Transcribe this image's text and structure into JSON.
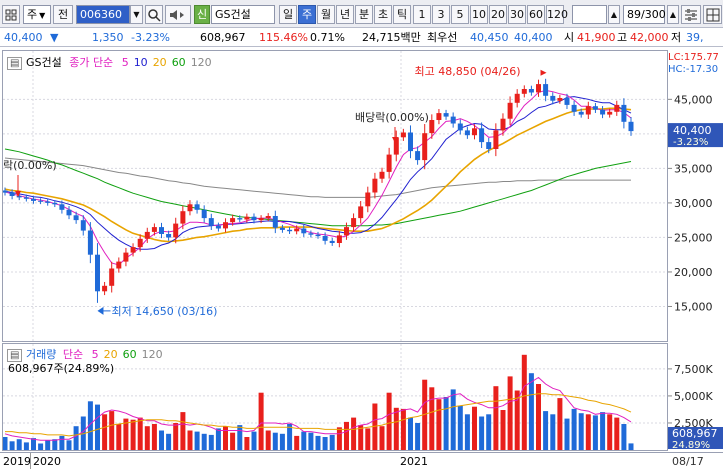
{
  "toolbar": {
    "grid_icon": "grid-icon",
    "market_label": "주",
    "prev_label": "전",
    "code": "006360",
    "search_icon": "search-icon",
    "speaker_icon": "speaker-icon",
    "credit_label": "신",
    "name": "GS건설",
    "periods": [
      "일",
      "주",
      "월",
      "년",
      "분",
      "초",
      "틱"
    ],
    "active_period": "주",
    "minutes": [
      "1",
      "3",
      "5",
      "10",
      "20",
      "30",
      "60",
      "120"
    ],
    "count": "89/300"
  },
  "quote": {
    "price": "40,400",
    "change": "1,350",
    "change_pct": "-3.23%",
    "volume": "608,967",
    "vol_ratio": "115.46%",
    "turnover": "0.71%",
    "amount": "24,715백만",
    "best_label": "최우선",
    "best_ask": "40,450",
    "best_bid": "40,400",
    "open_label": "시",
    "open": "41,900",
    "high_label": "고",
    "high": "42,000",
    "low_label": "저",
    "low": "39,"
  },
  "price_pane": {
    "legend_name": "GS건설",
    "legend_ma_label": "종가 단순",
    "ma_periods": [
      "5",
      "10",
      "20",
      "60",
      "120"
    ],
    "ma_colors": [
      "#e020c0",
      "#2020d0",
      "#e8a400",
      "#10a010",
      "#888888"
    ],
    "annot_high": "최고 48,850 (04/26)",
    "annot_low": "최저 14,650 (03/16)",
    "annot_div1": "배당락(0.00%)",
    "annot_div2": "락(0.00%)",
    "lc": "LC:175.77",
    "hc": "HC:-17.30",
    "last_price": "40,400",
    "last_pct": "-3.23%"
  },
  "volume_pane": {
    "legend_name": "거래량",
    "legend_ma_label": "단순",
    "ma_periods": [
      "5",
      "20",
      "60",
      "120"
    ],
    "value_label": "608,967주(24.89%)",
    "last_volume": "608,967",
    "last_pct": "24.89%"
  },
  "dates": {
    "x_labels": [
      "2019",
      "2020",
      "2021"
    ],
    "end_label": "08/17"
  },
  "colors": {
    "up": "#e8201c",
    "down": "#1f6ad8",
    "accent": "#3b6fd3"
  },
  "chart_data": [
    {
      "type": "candlestick",
      "title": "GS건설",
      "ylim": [
        10000,
        52000
      ],
      "y_ticks": [
        15000,
        20000,
        25000,
        30000,
        35000,
        40000,
        45000
      ],
      "x_labels": [
        "2019",
        "2020",
        "2021"
      ],
      "series": [
        {
          "name": "종가",
          "values": [
            31500,
            31000,
            30800,
            30600,
            30300,
            30200,
            30000,
            29800,
            29000,
            28200,
            27500,
            26000,
            22500,
            17200,
            18000,
            20500,
            21500,
            22800,
            23600,
            24800,
            25800,
            26500,
            25500,
            25000,
            27000,
            28800,
            29800,
            29000,
            27800,
            26700,
            26300,
            27200,
            27800,
            27600,
            28000,
            27500,
            27800,
            28100,
            26400,
            26100,
            25900,
            26300,
            25600,
            25400,
            25200,
            24500,
            24200,
            25300,
            26500,
            27800,
            29500,
            31500,
            33500,
            34500,
            37000,
            39500,
            40200,
            37500,
            36200,
            40100,
            42000,
            43000,
            42500,
            41500,
            40500,
            39800,
            40800,
            38800,
            37800,
            40500,
            42200,
            44500,
            45800,
            46500,
            46000,
            47200,
            45500,
            44800,
            45200,
            44200,
            43200,
            42800,
            44000,
            43500,
            42800,
            43200,
            44200,
            41750,
            40400
          ]
        },
        {
          "name": "5",
          "values": [
            31600,
            31300,
            31050,
            30800,
            30550,
            30400,
            30200,
            29900,
            29600,
            29050,
            28500,
            28050,
            26600,
            24500,
            22800,
            21300,
            21000,
            22000,
            22700,
            23600,
            24800,
            25500,
            25900,
            25800,
            25960,
            26700,
            27200,
            27200,
            27100,
            26800,
            26700,
            27000,
            27000,
            27100,
            27400,
            27700,
            27800,
            27800,
            27550,
            27200,
            26900,
            26500,
            26000,
            25700,
            25500,
            25400,
            25200,
            25000,
            25200,
            25900,
            26800,
            27800,
            29400,
            31100,
            33100,
            35200,
            37000,
            37800,
            38000,
            38800,
            39600,
            40800,
            41800,
            41900,
            42200,
            41800,
            41200,
            40400,
            39500,
            39600,
            40100,
            41100,
            42700,
            44100,
            45000,
            46000,
            46300,
            46100,
            45800,
            45600,
            44900,
            44000,
            44000,
            43700,
            43400,
            43500,
            43500,
            43100,
            42300
          ]
        },
        {
          "name": "10",
          "values": [
            31700,
            31500,
            31300,
            31100,
            30900,
            30800,
            30600,
            30300,
            30100,
            29800,
            29450,
            29000,
            28300,
            27200,
            26300,
            25400,
            24600,
            24000,
            23500,
            23300,
            23300,
            23400,
            23900,
            24200,
            24800,
            25700,
            26200,
            26500,
            26600,
            26700,
            26800,
            26900,
            26900,
            27000,
            27100,
            27200,
            27300,
            27400,
            27300,
            27300,
            27300,
            27100,
            26900,
            26600,
            26300,
            26100,
            25900,
            25800,
            25600,
            25600,
            25700,
            26100,
            26900,
            27900,
            29200,
            30500,
            31900,
            33400,
            34500,
            35400,
            36400,
            37800,
            39200,
            40000,
            40800,
            41200,
            41500,
            41400,
            40700,
            40600,
            40600,
            41000,
            41800,
            42300,
            43100,
            43800,
            44000,
            44400,
            44700,
            45300,
            45400,
            45200,
            45000,
            44700,
            44500,
            44500,
            44000,
            43500,
            43000
          ]
        },
        {
          "name": "20",
          "values": [
            32000,
            31800,
            31700,
            31500,
            31400,
            31200,
            31000,
            30800,
            30600,
            30300,
            30000,
            29700,
            29200,
            28600,
            28000,
            27300,
            26700,
            26100,
            25600,
            25300,
            25000,
            24700,
            24500,
            24400,
            24500,
            24600,
            24800,
            25000,
            25100,
            25300,
            25500,
            25700,
            25900,
            26000,
            26200,
            26300,
            26400,
            26400,
            26400,
            26500,
            26500,
            26500,
            26500,
            26500,
            26400,
            26300,
            26200,
            26100,
            26000,
            25900,
            25900,
            25900,
            26100,
            26300,
            26700,
            27200,
            27700,
            28300,
            28900,
            29600,
            30400,
            31400,
            32400,
            33400,
            34500,
            35400,
            36300,
            37000,
            37600,
            38100,
            38600,
            39200,
            39800,
            40300,
            40800,
            41300,
            41800,
            42200,
            42600,
            43000,
            43300,
            43500,
            43600,
            43600,
            43600,
            43700,
            43700,
            43600,
            43500
          ]
        },
        {
          "name": "60",
          "values": [
            37800,
            37600,
            37400,
            37100,
            36800,
            36500,
            36200,
            35800,
            35500,
            35100,
            34700,
            34300,
            33900,
            33500,
            33000,
            32600,
            32200,
            31800,
            31400,
            31100,
            30800,
            30500,
            30200,
            30000,
            29800,
            29600,
            29400,
            29200,
            29000,
            28800,
            28600,
            28400,
            28200,
            28000,
            27900,
            27800,
            27700,
            27600,
            27500,
            27400,
            27300,
            27200,
            27100,
            27000,
            26900,
            26800,
            26700,
            26700,
            26700,
            26700,
            26700,
            26700,
            26800,
            26800,
            26900,
            27000,
            27200,
            27400,
            27600,
            27800,
            28000,
            28200,
            28400,
            28600,
            28800,
            29100,
            29400,
            29700,
            30000,
            30300,
            30600,
            30900,
            31200,
            31500,
            31800,
            32200,
            32600,
            33000,
            33400,
            33800,
            34100,
            34400,
            34700,
            35000,
            35200,
            35400,
            35600,
            35800,
            36000
          ]
        },
        {
          "name": "120",
          "values": [
            36500,
            36400,
            36300,
            36200,
            36100,
            36000,
            35900,
            35800,
            35700,
            35600,
            35500,
            35400,
            35200,
            35000,
            34800,
            34600,
            34400,
            34300,
            34100,
            33900,
            33800,
            33600,
            33400,
            33200,
            33100,
            32900,
            32800,
            32600,
            32400,
            32300,
            32200,
            32100,
            32000,
            31900,
            31800,
            31700,
            31600,
            31500,
            31400,
            31300,
            31200,
            31100,
            31000,
            30900,
            30900,
            30800,
            30800,
            30800,
            30800,
            30800,
            30800,
            30800,
            30900,
            31000,
            31100,
            31200,
            31400,
            31600,
            31800,
            32000,
            32200,
            32300,
            32400,
            32500,
            32600,
            32700,
            32800,
            32900,
            33000,
            33000,
            33100,
            33100,
            33200,
            33200,
            33200,
            33300,
            33300,
            33300,
            33300,
            33300,
            33300,
            33300,
            33300,
            33300,
            33300,
            33300,
            33300,
            33300,
            33300
          ]
        }
      ]
    },
    {
      "type": "bar",
      "title": "거래량",
      "ylim": [
        0,
        9800000
      ],
      "y_ticks": [
        2500000,
        5000000,
        7500000
      ],
      "series": [
        {
          "name": "거래량",
          "values": [
            1200000,
            800000,
            1000000,
            700000,
            1100000,
            600000,
            900000,
            1000000,
            1300000,
            900000,
            2200000,
            3100000,
            4500000,
            4200000,
            3300000,
            3600000,
            2400000,
            2900000,
            2800000,
            3000000,
            2200000,
            2400000,
            1800000,
            1500000,
            2500000,
            3500000,
            1800000,
            1700000,
            1500000,
            1400000,
            2000000,
            2200000,
            1600000,
            2300000,
            1200000,
            1700000,
            5300000,
            1800000,
            1600000,
            1500000,
            2400000,
            1300000,
            1700000,
            1600000,
            1300000,
            1200000,
            1400000,
            2100000,
            2600000,
            3000000,
            2300000,
            2000000,
            4300000,
            2200000,
            5300000,
            3900000,
            3800000,
            3000000,
            2500000,
            6500000,
            5800000,
            4700000,
            4900000,
            5600000,
            4100000,
            3300000,
            4000000,
            3100000,
            3300000,
            5900000,
            3700000,
            6800000,
            5500000,
            8800000,
            7100000,
            6100000,
            3600000,
            3300000,
            4800000,
            2900000,
            3800000,
            3400000,
            3300000,
            3200000,
            3500000,
            3300000,
            3000000,
            2400000,
            610000
          ]
        },
        {
          "name": "5",
          "values": [
            1500000,
            1300000,
            1200000,
            1100000,
            1000000,
            900000,
            900000,
            900000,
            1000000,
            1000000,
            1300000,
            1700000,
            2400000,
            3000000,
            3500000,
            3700000,
            3600000,
            3400000,
            3100000,
            2900000,
            2700000,
            2700000,
            2400000,
            2300000,
            2300000,
            2400000,
            2300000,
            2400000,
            2300000,
            2100000,
            1800000,
            1800000,
            1800000,
            1800000,
            1700000,
            1800000,
            2500000,
            2500000,
            2500000,
            2400000,
            2500000,
            2200000,
            1700000,
            1700000,
            1600000,
            1500000,
            1500000,
            1500000,
            1700000,
            2100000,
            2300000,
            2400000,
            2800000,
            2900000,
            3300000,
            3500000,
            3700000,
            3800000,
            3500000,
            4400000,
            4700000,
            4800000,
            4800000,
            5100000,
            5200000,
            4700000,
            4400000,
            4200000,
            3900000,
            3900000,
            4100000,
            4500000,
            4600000,
            5900000,
            6300000,
            6700000,
            6100000,
            5700000,
            5500000,
            4700000,
            3900000,
            3700000,
            3600000,
            3300000,
            3400000,
            3400000,
            3300000,
            3000000,
            2600000
          ]
        },
        {
          "name": "20",
          "values": [
            1700000,
            1700000,
            1600000,
            1600000,
            1500000,
            1500000,
            1400000,
            1400000,
            1400000,
            1300000,
            1400000,
            1500000,
            1700000,
            1900000,
            2100000,
            2300000,
            2400000,
            2500000,
            2600000,
            2700000,
            2800000,
            2800000,
            2800000,
            2700000,
            2700000,
            2600000,
            2500000,
            2400000,
            2300000,
            2300000,
            2200000,
            2200000,
            2100000,
            2100000,
            2000000,
            2000000,
            2100000,
            2100000,
            2100000,
            2100000,
            2100000,
            2000000,
            2000000,
            2000000,
            2000000,
            1900000,
            1900000,
            1900000,
            1900000,
            1900000,
            2000000,
            2100000,
            2200000,
            2300000,
            2500000,
            2600000,
            2800000,
            3000000,
            3100000,
            3300000,
            3500000,
            3700000,
            3800000,
            4000000,
            4100000,
            4200000,
            4300000,
            4400000,
            4500000,
            4500000,
            4600000,
            4700000,
            4800000,
            5000000,
            5100000,
            5200000,
            5200000,
            5100000,
            5100000,
            5000000,
            4900000,
            4800000,
            4600000,
            4500000,
            4300000,
            4200000,
            4000000,
            3800000,
            3500000
          ]
        }
      ]
    }
  ]
}
